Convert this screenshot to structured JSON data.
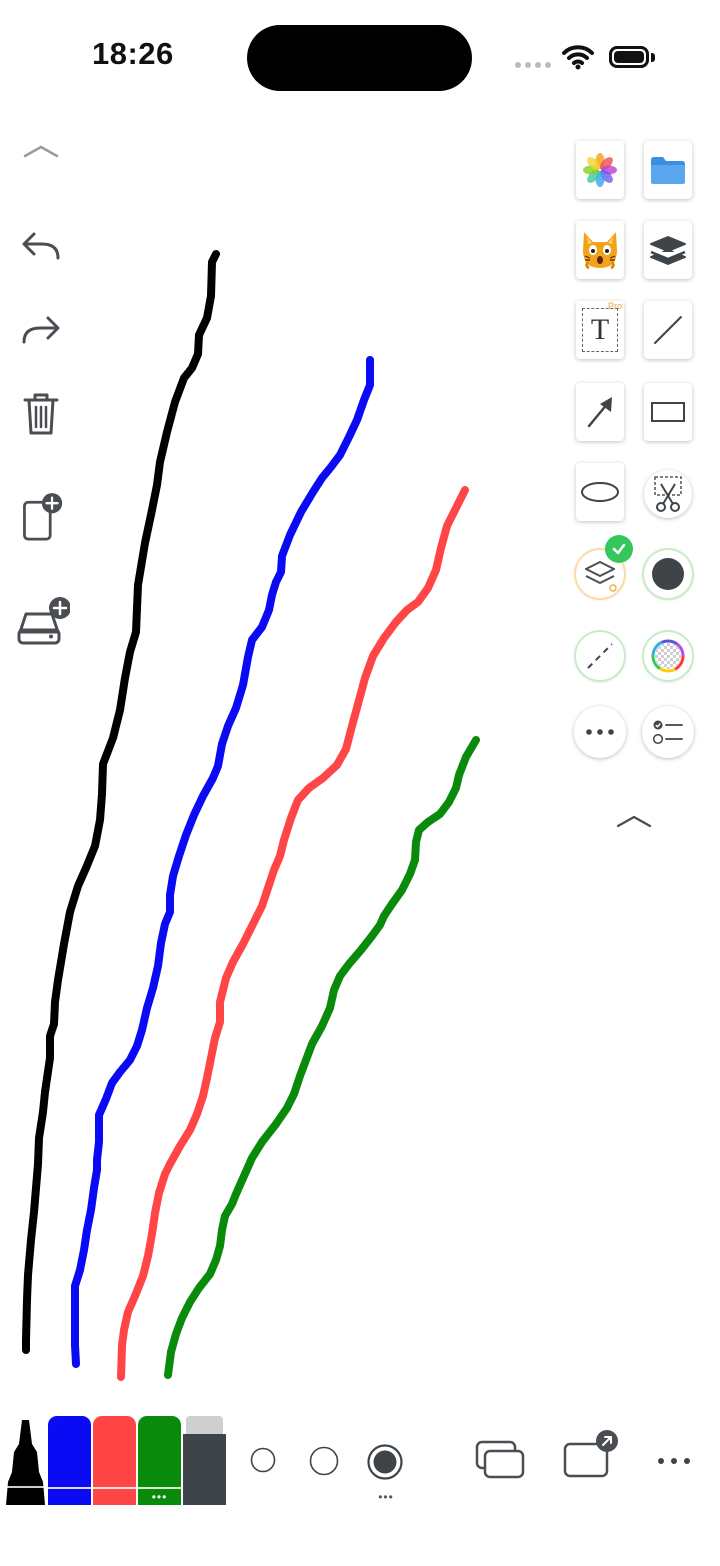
{
  "status_bar": {
    "time": "18:26"
  },
  "colors": {
    "ink_black": "#000000",
    "ink_blue": "#0a0af5",
    "ink_red": "#ff4545",
    "ink_green": "#0a8a0a",
    "ink_gray": "#3e4448",
    "icon_gray": "#4a4d52",
    "check_green": "#34c759"
  },
  "left_toolbar": [
    {
      "name": "collapse-up-icon"
    },
    {
      "name": "undo-icon"
    },
    {
      "name": "redo-icon"
    },
    {
      "name": "trash-icon"
    },
    {
      "name": "new-page-icon"
    },
    {
      "name": "add-storage-icon"
    }
  ],
  "right_toolbar": {
    "tools": [
      "photos-icon",
      "folder-icon",
      "cat-sticker-icon",
      "layers-icon",
      "text-tool-icon",
      "line-tool-icon",
      "arrow-tool-icon",
      "rectangle-tool-icon",
      "ellipse-tool-icon",
      "cut-selection-icon",
      "layer-settings-icon",
      "fill-circle-icon",
      "dashed-line-icon",
      "color-wheel-icon",
      "more-icon",
      "checklist-icon",
      "collapse-up-icon"
    ],
    "text_tool_glyph": "T",
    "pro_badge": "Pro"
  },
  "drawing": {
    "strokes": [
      {
        "color": "black",
        "label": "black stroke"
      },
      {
        "color": "blue",
        "label": "blue stroke"
      },
      {
        "color": "red",
        "label": "red stroke"
      },
      {
        "color": "green",
        "label": "green stroke"
      }
    ]
  },
  "bottom_bar": {
    "markers": [
      "black-pen",
      "blue-marker",
      "red-marker",
      "green-marker",
      "gray-marker"
    ],
    "marker_more": "•••",
    "size_options": [
      "small",
      "medium",
      "large"
    ],
    "size_more": "•••",
    "actions": [
      "windows-icon",
      "external-window-icon",
      "more-icon"
    ]
  }
}
